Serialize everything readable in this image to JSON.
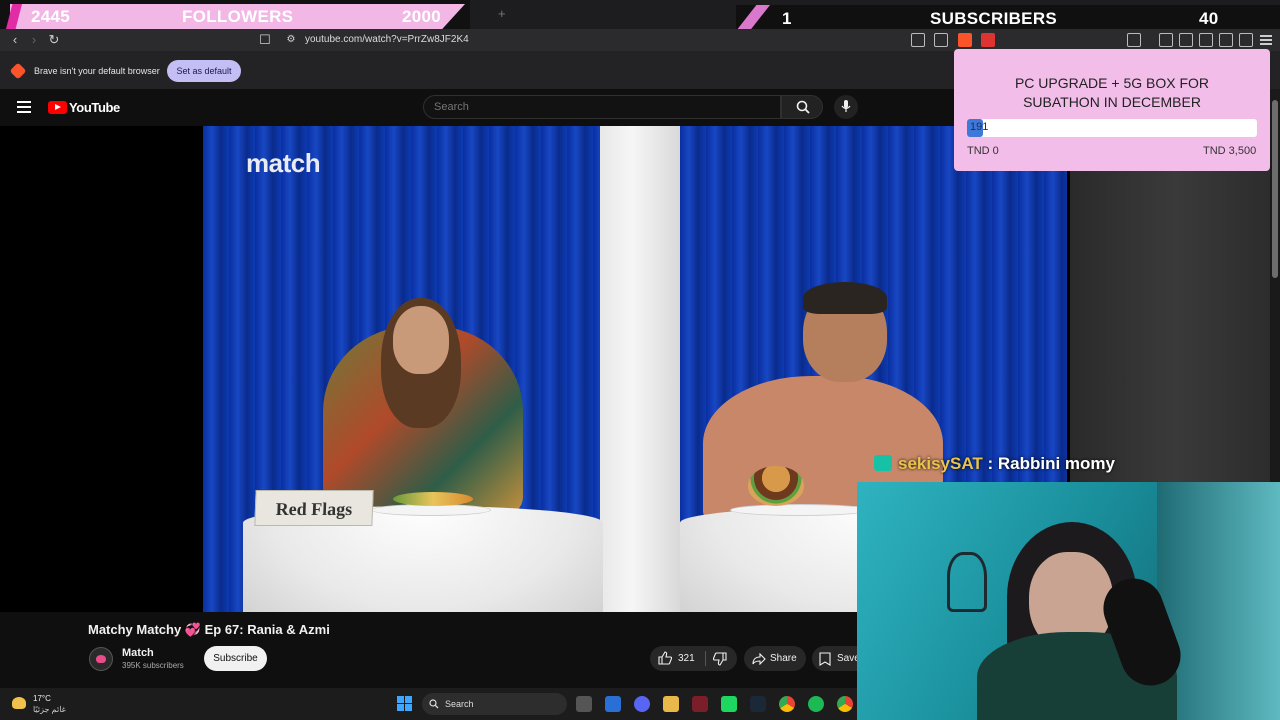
{
  "overlay": {
    "followers": {
      "current": "2445",
      "label": "FOLLOWERS",
      "goal": "2000"
    },
    "subscribers": {
      "current": "1",
      "label": "SUBSCRIBERS",
      "goal": "40"
    }
  },
  "browser": {
    "url": "youtube.com/watch?v=PrrZw8JF2K4",
    "infobar_text": "Brave isn't your default browser",
    "set_default_label": "Set as default"
  },
  "youtube": {
    "wordmark": "YouTube",
    "search_placeholder": "Search"
  },
  "video": {
    "overlay_logo": "match",
    "card_text": "Red Flags",
    "title": "Matchy Matchy 💞 Ep 67: Rania & Azmi",
    "channel_name": "Match",
    "channel_subs": "395K subscribers",
    "subscribe_label": "Subscribe",
    "like_count": "321",
    "share_label": "Share",
    "save_label": "Save"
  },
  "goal_widget": {
    "title_line1": "PC UPGRADE + 5G BOX FOR",
    "title_line2": "SUBATHON IN DECEMBER",
    "current": "191",
    "min_label": "TND 0",
    "max_label": "TND 3,500",
    "progress_fraction": 0.0546
  },
  "chat_alert": {
    "user": "sekisySAT",
    "message": " : Rabbini momy"
  },
  "taskbar": {
    "temperature": "17°C",
    "weather_desc": "غائم جزئيًا",
    "search_label": "Search"
  },
  "colors": {
    "overlay_pink": "#f3b7e6",
    "overlay_magenta": "#e22ca6",
    "goal_fill": "#3f78d6",
    "youtube_red": "#ff0000",
    "brave_orange": "#fb542b"
  }
}
